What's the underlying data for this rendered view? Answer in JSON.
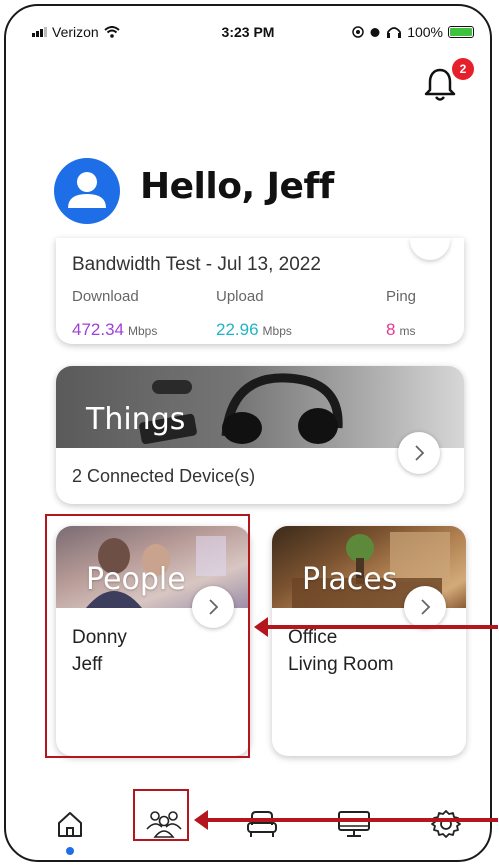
{
  "status_bar": {
    "carrier": "Verizon",
    "time": "3:23 PM",
    "battery": "100%"
  },
  "notifications": {
    "badge_count": "2"
  },
  "greeting": {
    "text": "Hello, Jeff"
  },
  "bandwidth": {
    "title": "Bandwidth Test - Jul 13, 2022",
    "download_label": "Download",
    "upload_label": "Upload",
    "ping_label": "Ping",
    "download_value": "472.34",
    "download_unit": "Mbps",
    "upload_value": "22.96",
    "upload_unit": "Mbps",
    "ping_value": "8",
    "ping_unit": "ms",
    "colors": {
      "download": "#a23fd8",
      "upload": "#20b5c4",
      "ping": "#e43a8c"
    }
  },
  "things": {
    "label": "Things",
    "subtitle": "2 Connected Device(s)"
  },
  "people": {
    "label": "People",
    "members": [
      "Donny",
      "Jeff"
    ]
  },
  "places": {
    "label": "Places",
    "rooms": [
      "Office",
      "Living Room"
    ]
  },
  "tabbar": {
    "tabs": [
      "home-icon",
      "people-icon",
      "seat-icon",
      "monitor-icon",
      "gear-icon"
    ],
    "active": "home-icon"
  },
  "colors": {
    "accent": "#1e6ee8",
    "annotation": "#b3161c",
    "badge": "#e5202b"
  }
}
